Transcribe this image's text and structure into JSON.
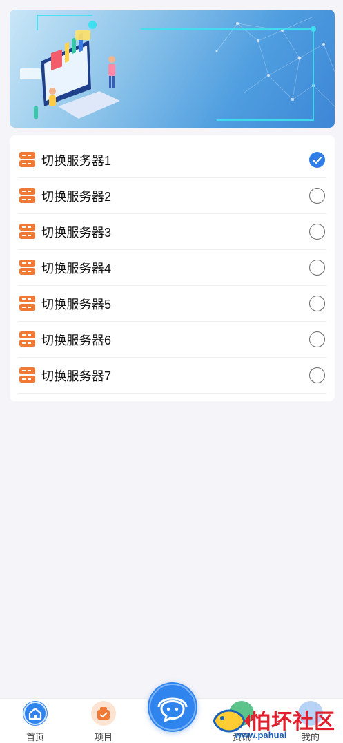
{
  "servers": {
    "items": [
      {
        "label": "切换服务器1",
        "selected": true
      },
      {
        "label": "切换服务器2",
        "selected": false
      },
      {
        "label": "切换服务器3",
        "selected": false
      },
      {
        "label": "切换服务器4",
        "selected": false
      },
      {
        "label": "切换服务器5",
        "selected": false
      },
      {
        "label": "切换服务器6",
        "selected": false
      },
      {
        "label": "切换服务器7",
        "selected": false
      }
    ],
    "icon": "server-icon",
    "icon_color": "#f07a35",
    "selected_color": "#2f7de8"
  },
  "tabbar": {
    "tabs": [
      {
        "label": "首页",
        "icon": "home-icon",
        "color": "#2f84ee"
      },
      {
        "label": "项目",
        "icon": "project-icon",
        "color": "#f4a46a"
      },
      {
        "label": "资讯",
        "icon": "news-icon",
        "color": "#5cc38a"
      },
      {
        "label": "我的",
        "icon": "user-icon",
        "color": "#7fb3f0"
      }
    ],
    "center_icon": "customer-service-icon"
  },
  "watermark": {
    "text": "怕坏社区",
    "url": "www.pahuai"
  }
}
